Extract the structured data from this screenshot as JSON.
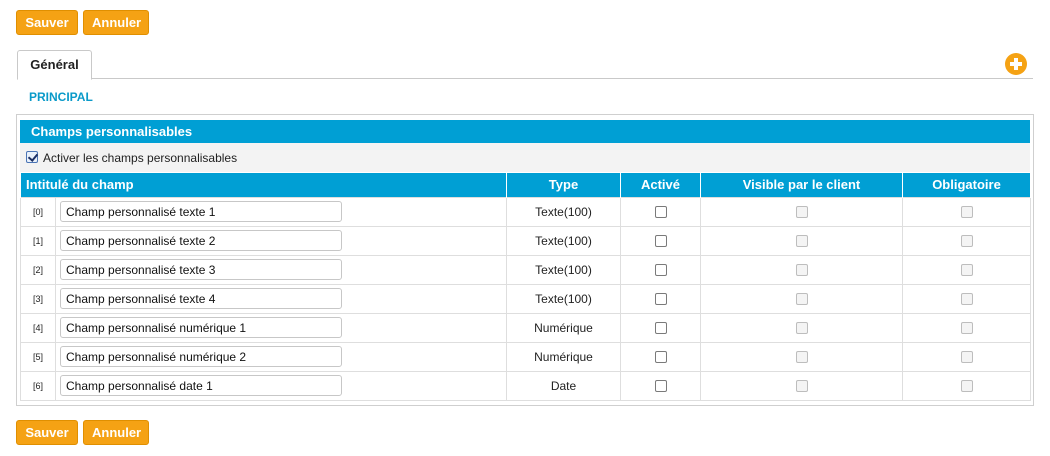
{
  "toolbar": {
    "save_label": "Sauver",
    "cancel_label": "Annuler"
  },
  "tabs": [
    {
      "label": "Général"
    }
  ],
  "section_link": "PRINCIPAL",
  "panel": {
    "title": "Champs personnalisables",
    "activate_label": "Activer les champs personnalisables",
    "activate_checked": true
  },
  "table": {
    "headers": {
      "name": "Intitulé du champ",
      "type": "Type",
      "active": "Activé",
      "visible": "Visible par le client",
      "required": "Obligatoire"
    },
    "rows": [
      {
        "index": "[0]",
        "name": "Champ personnalisé texte 1",
        "type": "Texte(100)"
      },
      {
        "index": "[1]",
        "name": "Champ personnalisé texte 2",
        "type": "Texte(100)"
      },
      {
        "index": "[2]",
        "name": "Champ personnalisé texte 3",
        "type": "Texte(100)"
      },
      {
        "index": "[3]",
        "name": "Champ personnalisé texte 4",
        "type": "Texte(100)"
      },
      {
        "index": "[4]",
        "name": "Champ personnalisé numérique 1",
        "type": "Numérique"
      },
      {
        "index": "[5]",
        "name": "Champ personnalisé numérique 2",
        "type": "Numérique"
      },
      {
        "index": "[6]",
        "name": "Champ personnalisé date 1",
        "type": "Date"
      }
    ]
  },
  "icons": {
    "add": "plus-circle-icon",
    "checkbox_checked": "checkbox-checked-icon"
  },
  "colors": {
    "accent_orange": "#f5a214",
    "header_blue": "#009fd4",
    "link_blue": "#0a9ac9"
  }
}
